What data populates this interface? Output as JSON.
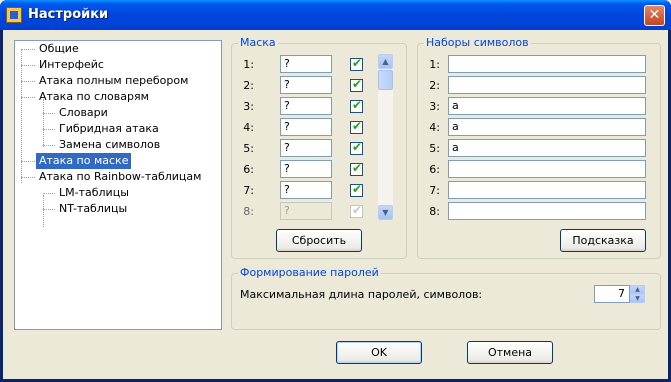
{
  "window": {
    "title": "Настройки",
    "close_symbol": "✕"
  },
  "tree": {
    "items": [
      {
        "label": "Общие",
        "level": 0
      },
      {
        "label": "Интерфейс",
        "level": 0
      },
      {
        "label": "Атака полным перебором",
        "level": 0
      },
      {
        "label": "Атака по словарям",
        "level": 0
      },
      {
        "label": "Словари",
        "level": 1
      },
      {
        "label": "Гибридная атака",
        "level": 1
      },
      {
        "label": "Замена символов",
        "level": 1
      },
      {
        "label": "Атака по маске",
        "level": 0,
        "selected": true
      },
      {
        "label": "Атака по Rainbow-таблицам",
        "level": 0
      },
      {
        "label": "LM-таблицы",
        "level": 1
      },
      {
        "label": "NT-таблицы",
        "level": 1
      }
    ]
  },
  "mask": {
    "title": "Маска",
    "rows": [
      {
        "num": "1:",
        "value": "?",
        "checked": true
      },
      {
        "num": "2:",
        "value": "?",
        "checked": true
      },
      {
        "num": "3:",
        "value": "?",
        "checked": true
      },
      {
        "num": "4:",
        "value": "?",
        "checked": true
      },
      {
        "num": "5:",
        "value": "?",
        "checked": true
      },
      {
        "num": "6:",
        "value": "?",
        "checked": true
      },
      {
        "num": "7:",
        "value": "?",
        "checked": true
      },
      {
        "num": "8:",
        "value": "?",
        "checked": true,
        "disabled": true
      }
    ],
    "reset_label": "Сбросить"
  },
  "charsets": {
    "title": "Наборы символов",
    "rows": [
      {
        "num": "1:",
        "value": ""
      },
      {
        "num": "2:",
        "value": ""
      },
      {
        "num": "3:",
        "value": "a"
      },
      {
        "num": "4:",
        "value": "a"
      },
      {
        "num": "5:",
        "value": "a"
      },
      {
        "num": "6:",
        "value": ""
      },
      {
        "num": "7:",
        "value": ""
      },
      {
        "num": "8:",
        "value": ""
      }
    ],
    "hint_label": "Подсказка"
  },
  "passwords": {
    "title": "Формирование паролей",
    "max_length_label": "Максимальная длина паролей, символов:",
    "max_length_value": "7"
  },
  "footer": {
    "ok_label": "OK",
    "cancel_label": "Отмена"
  }
}
